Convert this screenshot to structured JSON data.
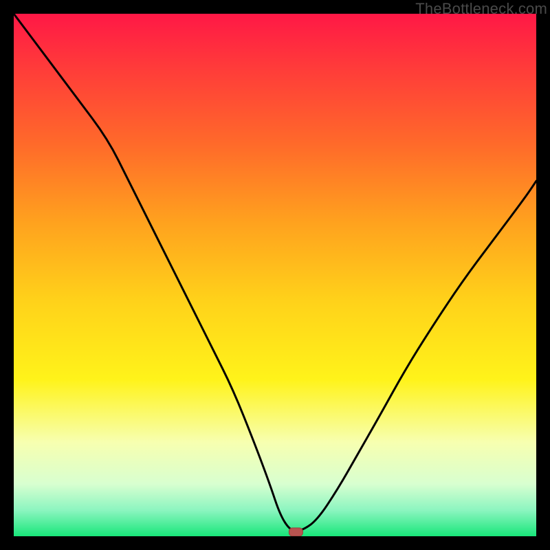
{
  "watermark": "TheBottleneck.com",
  "colors": {
    "frame": "#000000",
    "curve": "#000000",
    "marker_fill": "#b85450",
    "marker_stroke": "#9a3f3c",
    "gradient_stops": [
      {
        "offset": 0.0,
        "color": "#ff1846"
      },
      {
        "offset": 0.1,
        "color": "#ff3a3a"
      },
      {
        "offset": 0.25,
        "color": "#ff6a2a"
      },
      {
        "offset": 0.4,
        "color": "#ffa21e"
      },
      {
        "offset": 0.55,
        "color": "#ffd21a"
      },
      {
        "offset": 0.7,
        "color": "#fff31a"
      },
      {
        "offset": 0.82,
        "color": "#f7ffb0"
      },
      {
        "offset": 0.9,
        "color": "#d8ffd0"
      },
      {
        "offset": 0.95,
        "color": "#8cf5c0"
      },
      {
        "offset": 1.0,
        "color": "#18e67a"
      }
    ]
  },
  "chart_data": {
    "type": "line",
    "title": "",
    "xlabel": "",
    "ylabel": "",
    "xlim": [
      0,
      100
    ],
    "ylim": [
      0,
      100
    ],
    "series": [
      {
        "name": "bottleneck-curve",
        "x": [
          0,
          6,
          12,
          18,
          22,
          26,
          30,
          34,
          38,
          42,
          46,
          49,
          51,
          53,
          55,
          58,
          62,
          66,
          70,
          75,
          80,
          86,
          92,
          98,
          100
        ],
        "y": [
          100,
          92,
          84,
          76,
          68,
          60,
          52,
          44,
          36,
          28,
          18,
          10,
          4,
          1,
          1,
          3,
          9,
          16,
          23,
          32,
          40,
          49,
          57,
          65,
          68
        ]
      }
    ],
    "marker": {
      "x": 54,
      "y": 0.8,
      "shape": "rounded-rect"
    },
    "background": "vertical-gradient-red-to-green"
  }
}
